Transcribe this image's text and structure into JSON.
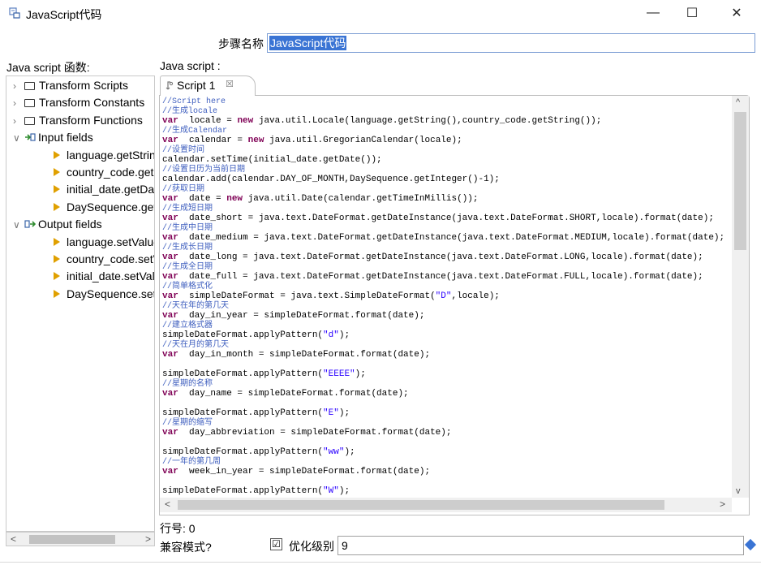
{
  "window": {
    "title": "JavaScript代码",
    "minimize": "—",
    "maximize": "☐",
    "close": "✕"
  },
  "step": {
    "label": "步骤名称",
    "value": "JavaScript代码"
  },
  "left": {
    "label": "Java script 函数:",
    "tree": [
      {
        "label": "Transform Scripts",
        "kind": "folder",
        "expanded": false
      },
      {
        "label": "Transform Constants",
        "kind": "folder",
        "expanded": false
      },
      {
        "label": "Transform Functions",
        "kind": "folder",
        "expanded": false
      },
      {
        "label": "Input fields",
        "kind": "input",
        "expanded": true
      },
      {
        "label": "language.getString()",
        "kind": "field"
      },
      {
        "label": "country_code.getString()",
        "kind": "field"
      },
      {
        "label": "initial_date.getDate()",
        "kind": "field"
      },
      {
        "label": "DaySequence.getInteger()",
        "kind": "field"
      },
      {
        "label": "Output fields",
        "kind": "output",
        "expanded": true
      },
      {
        "label": "language.setValue()",
        "kind": "field"
      },
      {
        "label": "country_code.setValue()",
        "kind": "field"
      },
      {
        "label": "initial_date.setValue()",
        "kind": "field"
      },
      {
        "label": "DaySequence.setValue()",
        "kind": "field"
      }
    ]
  },
  "right": {
    "label": "Java script :",
    "tab_label": "Script 1",
    "tab_close": "☒"
  },
  "code_lines": [
    [
      [
        "cm",
        "//Script here"
      ]
    ],
    [
      [
        "cm",
        "//生成locale"
      ]
    ],
    [
      [
        "kw",
        "var"
      ],
      [
        "",
        "  locale = "
      ],
      [
        "kw",
        "new"
      ],
      [
        "",
        " java.util.Locale(language.getString(),country_code.getString());"
      ]
    ],
    [
      [
        "cm",
        "//生成Calendar"
      ]
    ],
    [
      [
        "kw",
        "var"
      ],
      [
        "",
        "  calendar = "
      ],
      [
        "kw",
        "new"
      ],
      [
        "",
        " java.util.GregorianCalendar(locale);"
      ]
    ],
    [
      [
        "cm",
        "//设置时间"
      ]
    ],
    [
      [
        "",
        "calendar.setTime(initial_date.getDate());"
      ]
    ],
    [
      [
        "cm",
        "//设置日历为当前日期"
      ]
    ],
    [
      [
        "",
        "calendar.add(calendar.DAY_OF_MONTH,DaySequence.getInteger()-1);"
      ]
    ],
    [
      [
        "cm",
        "//获取日期"
      ]
    ],
    [
      [
        "kw",
        "var"
      ],
      [
        "",
        "  date = "
      ],
      [
        "kw",
        "new"
      ],
      [
        "",
        " java.util.Date(calendar.getTimeInMillis());"
      ]
    ],
    [
      [
        "cm",
        "//生成短日期"
      ]
    ],
    [
      [
        "kw",
        "var"
      ],
      [
        "",
        "  date_short = java.text.DateFormat.getDateInstance(java.text.DateFormat.SHORT,locale).format(date);"
      ]
    ],
    [
      [
        "cm",
        "//生成中日期"
      ]
    ],
    [
      [
        "kw",
        "var"
      ],
      [
        "",
        "  date_medium = java.text.DateFormat.getDateInstance(java.text.DateFormat.MEDIUM,locale).format(date);"
      ]
    ],
    [
      [
        "cm",
        "//生成长日期"
      ]
    ],
    [
      [
        "kw",
        "var"
      ],
      [
        "",
        "  date_long = java.text.DateFormat.getDateInstance(java.text.DateFormat.LONG,locale).format(date);"
      ]
    ],
    [
      [
        "cm",
        "//生成全日期"
      ]
    ],
    [
      [
        "kw",
        "var"
      ],
      [
        "",
        "  date_full = java.text.DateFormat.getDateInstance(java.text.DateFormat.FULL,locale).format(date);"
      ]
    ],
    [
      [
        "cm",
        "//简单格式化"
      ]
    ],
    [
      [
        "kw",
        "var"
      ],
      [
        "",
        "  simpleDateFormat = java.text.SimpleDateFormat("
      ],
      [
        "st",
        "\"D\""
      ],
      [
        "",
        ",locale);"
      ]
    ],
    [
      [
        "cm",
        "//天在年的第几天"
      ]
    ],
    [
      [
        "kw",
        "var"
      ],
      [
        "",
        "  day_in_year = simpleDateFormat.format(date);"
      ]
    ],
    [
      [
        "cm",
        "//建立格式器"
      ]
    ],
    [
      [
        "",
        "simpleDateFormat.applyPattern("
      ],
      [
        "st",
        "\"d\""
      ],
      [
        "",
        ");"
      ]
    ],
    [
      [
        "cm",
        "//天在月的第几天"
      ]
    ],
    [
      [
        "kw",
        "var"
      ],
      [
        "",
        "  day_in_month = simpleDateFormat.format(date);"
      ]
    ],
    [
      [
        "",
        ""
      ]
    ],
    [
      [
        "",
        "simpleDateFormat.applyPattern("
      ],
      [
        "st",
        "\"EEEE\""
      ],
      [
        "",
        ");"
      ]
    ],
    [
      [
        "cm",
        "//星期的名称"
      ]
    ],
    [
      [
        "kw",
        "var"
      ],
      [
        "",
        "  day_name = simpleDateFormat.format(date);"
      ]
    ],
    [
      [
        "",
        ""
      ]
    ],
    [
      [
        "",
        "simpleDateFormat.applyPattern("
      ],
      [
        "st",
        "\"E\""
      ],
      [
        "",
        ");"
      ]
    ],
    [
      [
        "cm",
        "//星期的缩写"
      ]
    ],
    [
      [
        "kw",
        "var"
      ],
      [
        "",
        "  day_abbreviation = simpleDateFormat.format(date);"
      ]
    ],
    [
      [
        "",
        ""
      ]
    ],
    [
      [
        "",
        "simpleDateFormat.applyPattern("
      ],
      [
        "st",
        "\"ww\""
      ],
      [
        "",
        ");"
      ]
    ],
    [
      [
        "cm",
        "//一年的第几周"
      ]
    ],
    [
      [
        "kw",
        "var"
      ],
      [
        "",
        "  week_in_year = simpleDateFormat.format(date);"
      ]
    ],
    [
      [
        "",
        ""
      ]
    ],
    [
      [
        "",
        "simpleDateFormat.applyPattern("
      ],
      [
        "st",
        "\"W\""
      ],
      [
        "",
        ");"
      ]
    ]
  ],
  "status": {
    "line_number": "行号: 0",
    "compat_label": "兼容模式?",
    "optimize_checked": "☑",
    "optimize_label": "优化级别",
    "optimize_value": "9"
  },
  "scroll_arrows": {
    "left": "<",
    "right": ">",
    "up": "^",
    "down": "v"
  },
  "colors": {
    "comment": "#3f5fbf",
    "keyword": "#7f0055",
    "string": "#2a00ff",
    "selection": "#3a74d4"
  }
}
